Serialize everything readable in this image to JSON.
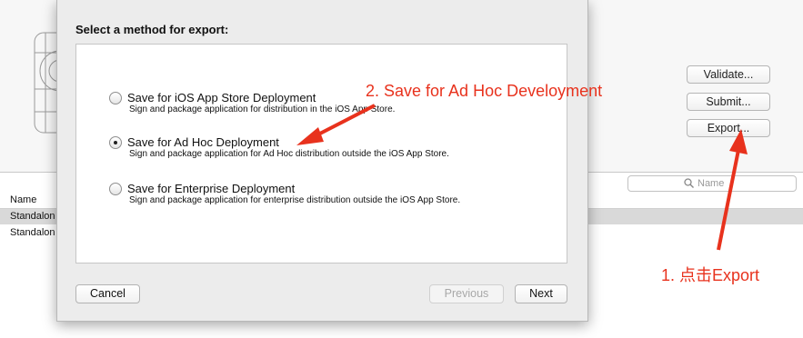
{
  "background_window": {
    "buttons": {
      "validate": "Validate...",
      "submit": "Submit...",
      "export": "Export..."
    },
    "search": {
      "placeholder": "Name"
    },
    "list": {
      "header": "Name",
      "rows": [
        "Standalon",
        "Standalon"
      ]
    }
  },
  "dialog": {
    "title": "Select a method for export:",
    "options": [
      {
        "label": "Save for iOS App Store Deployment",
        "description": "Sign and package application for distribution in the iOS App Store.",
        "selected": false
      },
      {
        "label": "Save for Ad Hoc Deployment",
        "description": "Sign and package application for Ad Hoc distribution outside the iOS App Store.",
        "selected": true
      },
      {
        "label": "Save for Enterprise Deployment",
        "description": "Sign and package application for enterprise distribution outside the iOS App Store.",
        "selected": false
      }
    ],
    "buttons": {
      "cancel": "Cancel",
      "previous": "Previous",
      "next": "Next"
    }
  },
  "annotations": {
    "step1": "1. 点击Export",
    "step2": "2. Save for Ad Hoc Develoyment",
    "color": "#e8321d"
  }
}
